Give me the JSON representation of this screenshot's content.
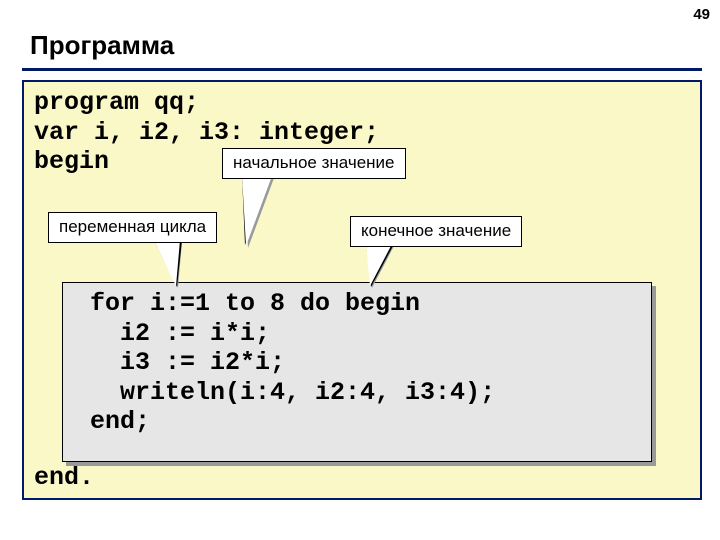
{
  "page_number": "49",
  "title": "Программа",
  "code_top": "program qq;\nvar i, i2, i3: integer;\nbegin",
  "code_bottom": "end.",
  "callouts": {
    "initial_value": "начальное значение",
    "loop_variable": "переменная цикла",
    "final_value": "конечное значение"
  },
  "inner_code": " for i:=1 to 8 do begin\n   i2 := i*i;\n   i3 := i2*i;\n   writeln(i:4, i2:4, i3:4);\n end;"
}
